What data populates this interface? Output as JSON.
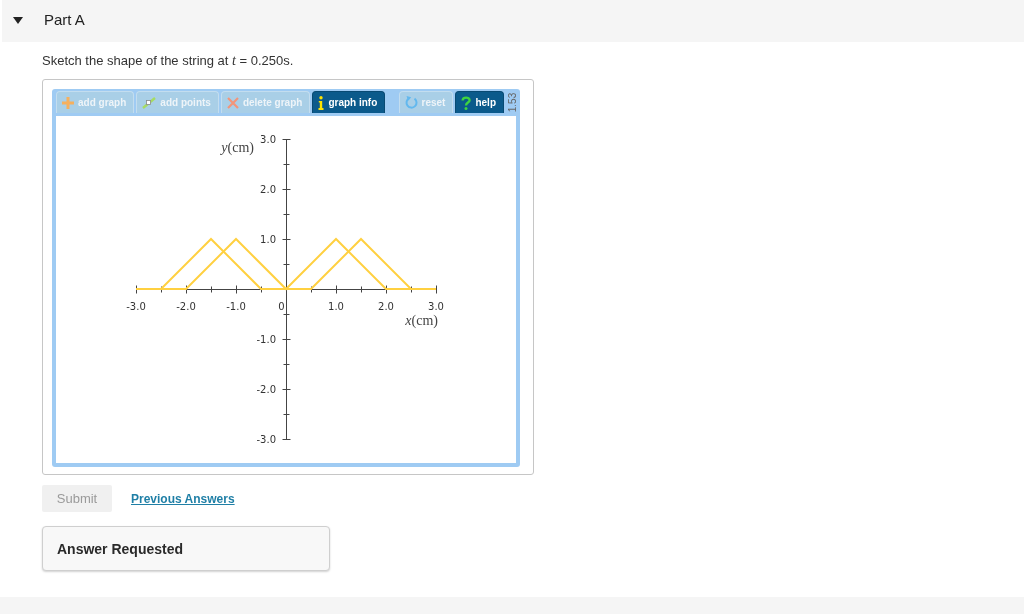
{
  "part": {
    "title": "Part A",
    "expanded": true
  },
  "question": {
    "prompt": "Sketch the shape of the string at *t* = 0.250s."
  },
  "graph_tool": {
    "toolbar": [
      {
        "kind": "add",
        "label": "add graph",
        "disabled": true
      },
      {
        "kind": "points",
        "label": "add points",
        "disabled": true
      },
      {
        "kind": "delete",
        "label": "delete graph",
        "disabled": true
      },
      {
        "kind": "info",
        "label": "graph info",
        "disabled": false
      }
    ],
    "toolbar_right": [
      {
        "kind": "reset",
        "label": "reset",
        "disabled": true
      },
      {
        "kind": "help",
        "label": "help",
        "disabled": false
      }
    ],
    "version": "1.53",
    "chart_data": [
      {
        "type": "line",
        "xlabel": "*x*(cm)",
        "ylabel": "*y*(cm)",
        "xlim": [
          -3,
          3
        ],
        "ylim": [
          -3,
          3
        ],
        "xticks": [
          {
            "value": -3,
            "label": "-3.0"
          },
          {
            "value": -2,
            "label": "-2.0"
          },
          {
            "value": -1,
            "label": "-1.0"
          },
          {
            "value": 0,
            "label": "0"
          },
          {
            "value": 1,
            "label": "1.0"
          },
          {
            "value": 2,
            "label": "2.0"
          },
          {
            "value": 3,
            "label": "3.0"
          }
        ],
        "yticks": [
          {
            "value": 3,
            "label": "3.0"
          },
          {
            "value": 2,
            "label": "2.0"
          },
          {
            "value": 1,
            "label": "1.0"
          },
          {
            "value": -1,
            "label": "-1.0"
          },
          {
            "value": -2,
            "label": "-2.0"
          },
          {
            "value": -3,
            "label": "-3.0"
          }
        ],
        "series": [
          {
            "color": "#ffd040",
            "x": [
              -3,
              -2.5,
              -1.5,
              -0.5,
              0.5,
              1.5,
              2.5,
              3
            ],
            "values": [
              0,
              0,
              1,
              0,
              0,
              1,
              0,
              0
            ]
          },
          {
            "color": "#ffd040",
            "x": [
              -3,
              -2,
              -1,
              0,
              1,
              2,
              3
            ],
            "values": [
              0,
              0,
              1,
              0,
              1,
              0,
              0
            ]
          }
        ]
      }
    ]
  },
  "submit_button": {
    "label": "Submit",
    "disabled": true
  },
  "previous_answers_link": {
    "label": "Previous Answers"
  },
  "feedback": {
    "title": "Answer Requested"
  }
}
